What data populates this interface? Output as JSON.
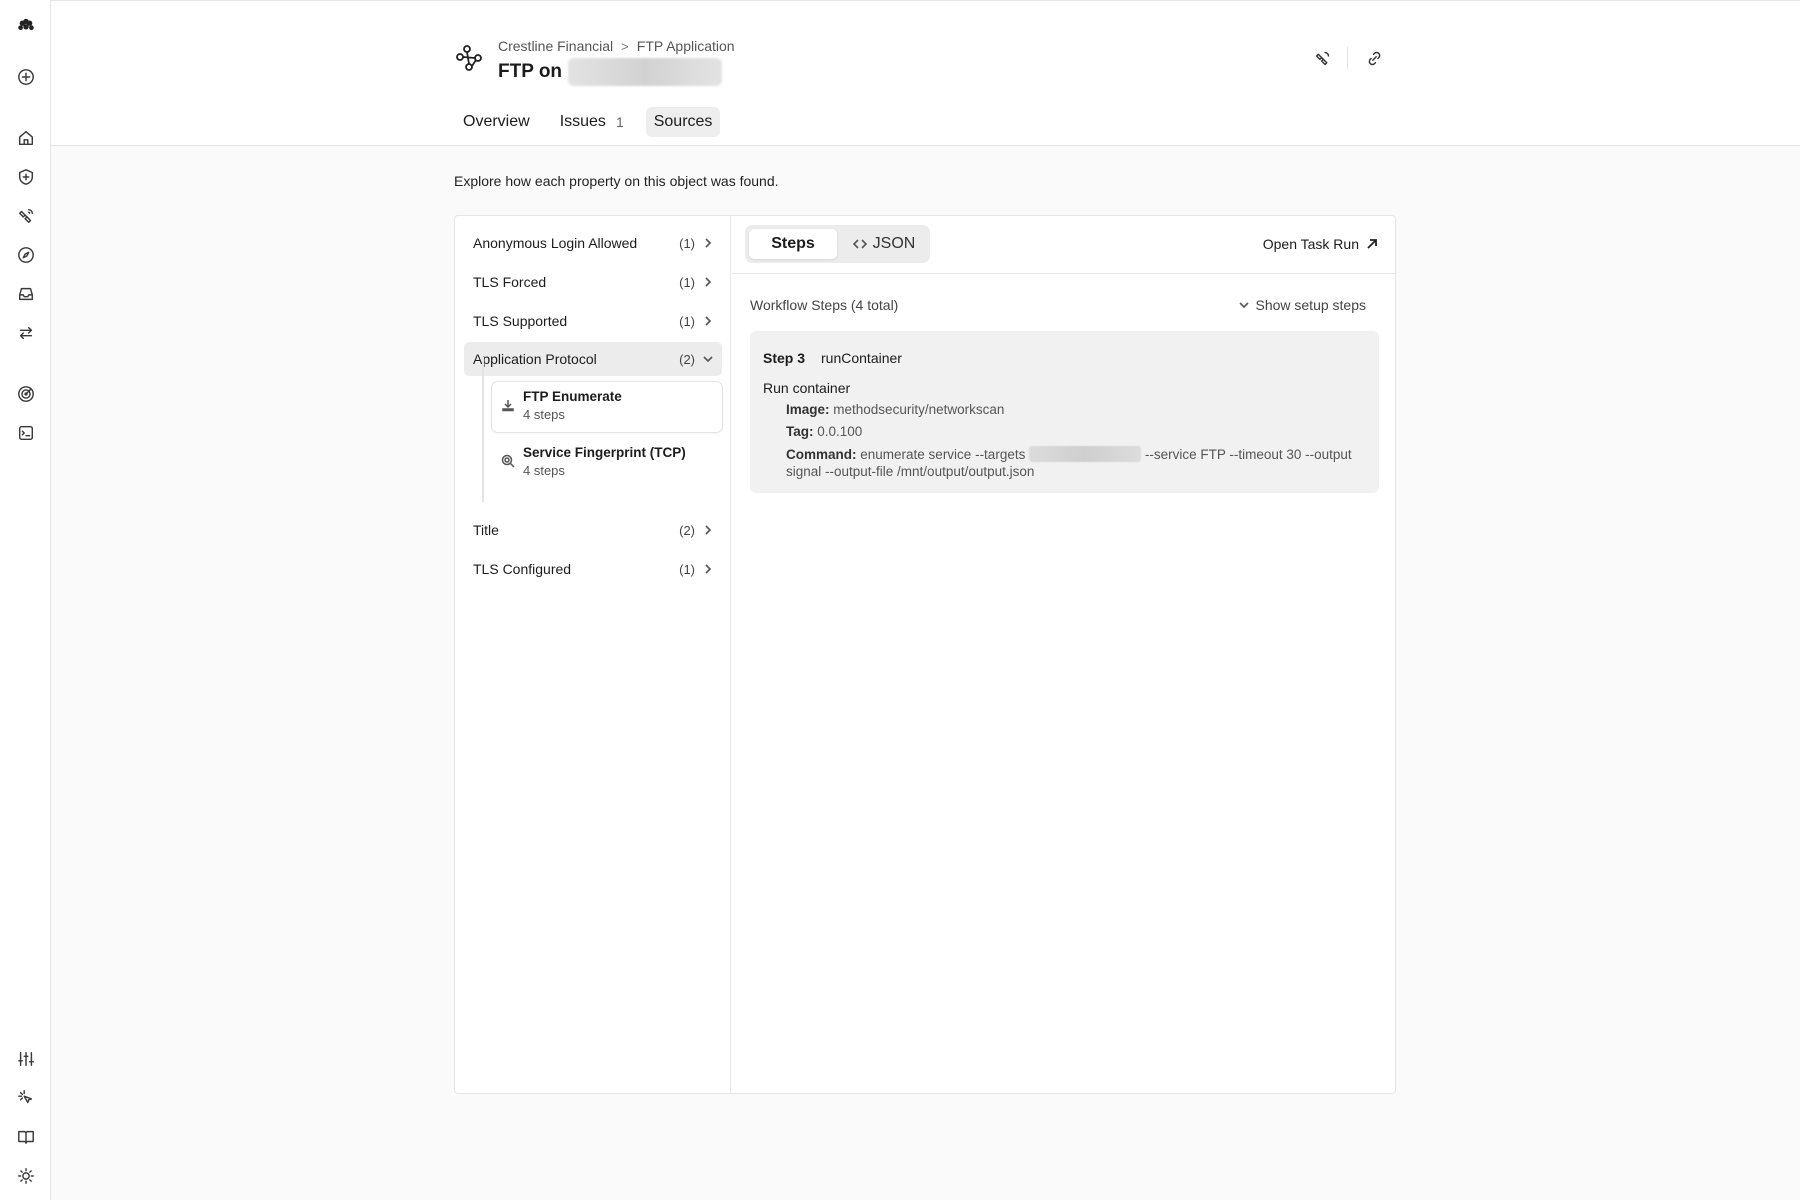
{
  "header": {
    "breadcrumbs": [
      "Crestline Financial",
      "FTP Application"
    ],
    "breadcrumb_sep": ">",
    "title": "FTP on"
  },
  "tabs": [
    {
      "label": "Overview",
      "count": ""
    },
    {
      "label": "Issues",
      "count": "1"
    },
    {
      "label": "Sources",
      "count": ""
    }
  ],
  "intro": "Explore how each property on this object was found.",
  "properties": [
    {
      "label": "Anonymous Login Allowed",
      "count": "(1)"
    },
    {
      "label": "TLS Forced",
      "count": "(1)"
    },
    {
      "label": "TLS Supported",
      "count": "(1)"
    },
    {
      "label": "Application Protocol",
      "count": "(2)"
    },
    {
      "label": "Title",
      "count": "(2)"
    },
    {
      "label": "TLS Configured",
      "count": "(1)"
    }
  ],
  "sources": [
    {
      "name": "FTP Enumerate",
      "meta": "4 steps",
      "icon": "download-icon"
    },
    {
      "name": "Service Fingerprint (TCP)",
      "meta": "4 steps",
      "icon": "fingerprint-search-icon"
    }
  ],
  "viewer": {
    "seg_steps": "Steps",
    "seg_json": "JSON",
    "open_task_run": "Open Task Run",
    "workflow_title": "Workflow Steps (4 total)",
    "show_setup": "Show setup steps",
    "step": {
      "number": "Step 3",
      "name": "runContainer",
      "subtitle": "Run container",
      "image_label": "Image:",
      "image_value": "methodsecurity/networkscan",
      "tag_label": "Tag:",
      "tag_value": "0.0.100",
      "command_label": "Command:",
      "command_pre": "enumerate service --targets",
      "command_post": "--service FTP --timeout 30 --output signal --output-file /mnt/output/output.json"
    }
  }
}
